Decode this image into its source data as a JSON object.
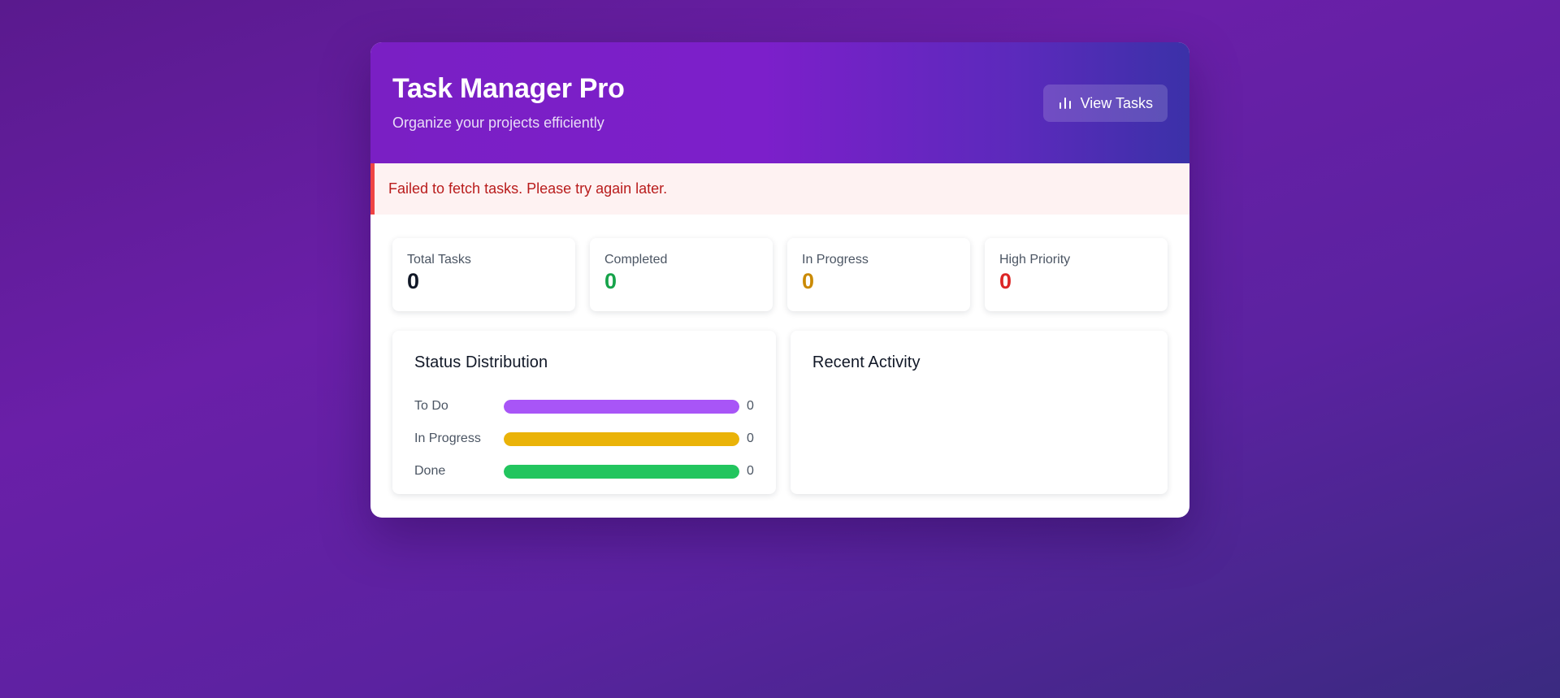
{
  "header": {
    "title": "Task Manager Pro",
    "subtitle": "Organize your projects efficiently",
    "view_tasks_label": "View Tasks",
    "view_tasks_icon": "bar-chart-icon"
  },
  "error": {
    "message": "Failed to fetch tasks. Please try again later."
  },
  "stats": [
    {
      "label": "Total Tasks",
      "value": "0",
      "color": "#111827"
    },
    {
      "label": "Completed",
      "value": "0",
      "color": "#16a34a"
    },
    {
      "label": "In Progress",
      "value": "0",
      "color": "#ca8a04"
    },
    {
      "label": "High Priority",
      "value": "0",
      "color": "#dc2626"
    }
  ],
  "status_distribution": {
    "title": "Status Distribution",
    "rows": [
      {
        "label": "To Do",
        "count": "0",
        "color": "#a855f7"
      },
      {
        "label": "In Progress",
        "count": "0",
        "color": "#eab308"
      },
      {
        "label": "Done",
        "count": "0",
        "color": "#22c55e"
      }
    ]
  },
  "recent_activity": {
    "title": "Recent Activity"
  },
  "colors": {
    "accent": "#7c1fca",
    "error_border": "#ef4444",
    "error_text": "#b91c1c",
    "error_bg": "#fef2f2"
  }
}
